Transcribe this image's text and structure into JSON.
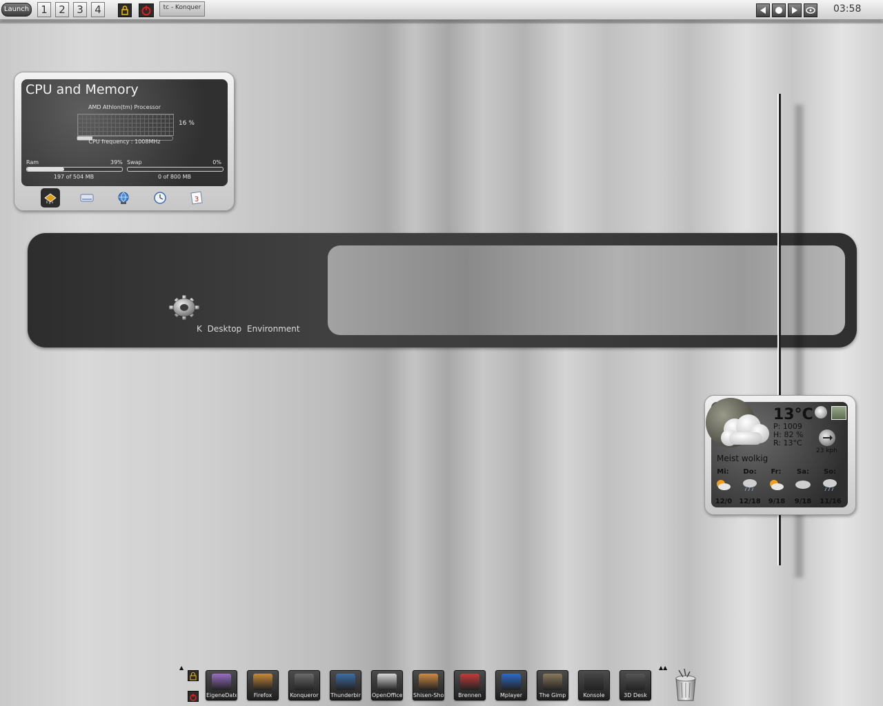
{
  "top_panel": {
    "launch_label": "Launch",
    "desktops": [
      "1",
      "2",
      "3",
      "4"
    ],
    "task_label": "tc - Konquer",
    "clock": "03:58",
    "media_buttons": [
      "previous-icon",
      "stop-icon",
      "play-icon",
      "eject-icon"
    ]
  },
  "cpu_widget": {
    "title": "CPU and Memory",
    "processor": "AMD Athlon(tm) Processor",
    "cpu_percent_label": "16 %",
    "cpu_load": 0.16,
    "cpu_frequency": "CPU frequency : 1008MHz",
    "ram_label": "Ram",
    "ram_percent": "39%",
    "ram_fill": 0.39,
    "ram_detail": "197 of 504 MB",
    "swap_label": "Swap",
    "swap_percent": "0%",
    "swap_fill": 0.0,
    "swap_detail": "0 of 800 MB",
    "tabs": [
      "cpu-chip-icon",
      "hard-drive-icon",
      "network-globe-icon",
      "clock-icon",
      "calendar-icon"
    ],
    "calendar_day": "3"
  },
  "banner": {
    "text": "K  Desktop  Environment"
  },
  "weather": {
    "temperature": "13°C",
    "pressure": "P: 1009",
    "humidity": "H: 82 %",
    "realfeel": "R: 13°C",
    "wind_speed": "23 kph",
    "condition": "Meist wolkig",
    "forecast": [
      {
        "day": "Mi:",
        "temps": "12/0",
        "icon": "sun-cloud-icon"
      },
      {
        "day": "Do:",
        "temps": "12/18",
        "icon": "rain-cloud-icon"
      },
      {
        "day": "Fr:",
        "temps": "9/18",
        "icon": "sun-cloud-icon"
      },
      {
        "day": "Sa:",
        "temps": "9/18",
        "icon": "cloud-icon"
      },
      {
        "day": "So:",
        "temps": "11/16",
        "icon": "rain-cloud-icon"
      }
    ]
  },
  "dock": {
    "items": [
      {
        "label": "EigeneDateien",
        "icon": "folder-icon",
        "color": "#9a6fc2"
      },
      {
        "label": "Firefox",
        "icon": "firefox-icon",
        "color": "#c98a3a"
      },
      {
        "label": "Konqueror",
        "icon": "konqueror-icon",
        "color": "#6a6a6a"
      },
      {
        "label": "Thunderbird",
        "icon": "thunderbird-icon",
        "color": "#3d6ea8"
      },
      {
        "label": "OpenOffice",
        "icon": "openoffice-icon",
        "color": "#d8d8d8"
      },
      {
        "label": "Shisen-Sho",
        "icon": "shisen-icon",
        "color": "#d08b44"
      },
      {
        "label": "Brennen",
        "icon": "burn-icon",
        "color": "#c43c3c"
      },
      {
        "label": "Mplayer",
        "icon": "mplayer-icon",
        "color": "#2c6cc8"
      },
      {
        "label": "The Gimp",
        "icon": "gimp-icon",
        "color": "#8a7a5a"
      },
      {
        "label": "Konsole",
        "icon": "konsole-icon",
        "color": "#444444"
      },
      {
        "label": "3D Desk",
        "icon": "3d-desk-icon",
        "color": "#555555"
      }
    ]
  }
}
